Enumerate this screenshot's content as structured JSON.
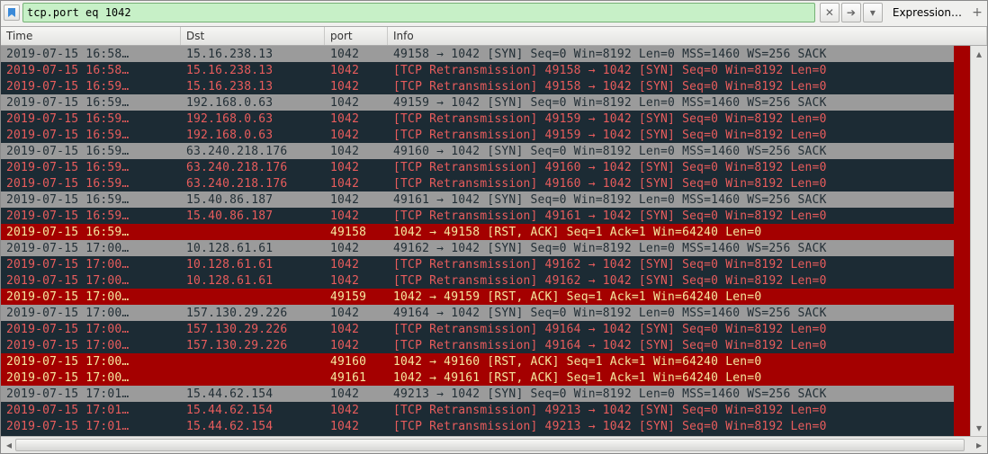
{
  "filter": {
    "value": "tcp.port eq 1042",
    "clear_label": "✕",
    "go_label": "➔",
    "expression_label": "Expression…",
    "plus_label": "+"
  },
  "columns": {
    "time": "Time",
    "dst": "Dst",
    "port": "port",
    "info": "Info"
  },
  "rows": [
    {
      "cls": "gray",
      "time": "2019-07-15 16:58…",
      "dst": "15.16.238.13",
      "port": "1042",
      "info": "49158 → 1042 [SYN] Seq=0 Win=8192 Len=0 MSS=1460 WS=256 SACK"
    },
    {
      "cls": "dark",
      "time": "2019-07-15 16:58…",
      "dst": "15.16.238.13",
      "port": "1042",
      "info": "[TCP Retransmission] 49158 → 1042 [SYN] Seq=0 Win=8192 Len=0"
    },
    {
      "cls": "dark",
      "time": "2019-07-15 16:59…",
      "dst": "15.16.238.13",
      "port": "1042",
      "info": "[TCP Retransmission] 49158 → 1042 [SYN] Seq=0 Win=8192 Len=0"
    },
    {
      "cls": "gray",
      "time": "2019-07-15 16:59…",
      "dst": "192.168.0.63",
      "port": "1042",
      "info": "49159 → 1042 [SYN] Seq=0 Win=8192 Len=0 MSS=1460 WS=256 SACK"
    },
    {
      "cls": "dark",
      "time": "2019-07-15 16:59…",
      "dst": "192.168.0.63",
      "port": "1042",
      "info": "[TCP Retransmission] 49159 → 1042 [SYN] Seq=0 Win=8192 Len=0"
    },
    {
      "cls": "dark",
      "time": "2019-07-15 16:59…",
      "dst": "192.168.0.63",
      "port": "1042",
      "info": "[TCP Retransmission] 49159 → 1042 [SYN] Seq=0 Win=8192 Len=0"
    },
    {
      "cls": "gray",
      "time": "2019-07-15 16:59…",
      "dst": "63.240.218.176",
      "port": "1042",
      "info": "49160 → 1042 [SYN] Seq=0 Win=8192 Len=0 MSS=1460 WS=256 SACK"
    },
    {
      "cls": "dark",
      "time": "2019-07-15 16:59…",
      "dst": "63.240.218.176",
      "port": "1042",
      "info": "[TCP Retransmission] 49160 → 1042 [SYN] Seq=0 Win=8192 Len=0"
    },
    {
      "cls": "dark",
      "time": "2019-07-15 16:59…",
      "dst": "63.240.218.176",
      "port": "1042",
      "info": "[TCP Retransmission] 49160 → 1042 [SYN] Seq=0 Win=8192 Len=0"
    },
    {
      "cls": "gray",
      "time": "2019-07-15 16:59…",
      "dst": "15.40.86.187",
      "port": "1042",
      "info": "49161 → 1042 [SYN] Seq=0 Win=8192 Len=0 MSS=1460 WS=256 SACK"
    },
    {
      "cls": "dark",
      "time": "2019-07-15 16:59…",
      "dst": "15.40.86.187",
      "port": "1042",
      "info": "[TCP Retransmission] 49161 → 1042 [SYN] Seq=0 Win=8192 Len=0"
    },
    {
      "cls": "red",
      "time": "2019-07-15 16:59…",
      "dst": "",
      "port": "49158",
      "info": "1042 → 49158 [RST, ACK] Seq=1 Ack=1 Win=64240 Len=0"
    },
    {
      "cls": "gray",
      "time": "2019-07-15 17:00…",
      "dst": "10.128.61.61",
      "port": "1042",
      "info": "49162 → 1042 [SYN] Seq=0 Win=8192 Len=0 MSS=1460 WS=256 SACK"
    },
    {
      "cls": "dark",
      "time": "2019-07-15 17:00…",
      "dst": "10.128.61.61",
      "port": "1042",
      "info": "[TCP Retransmission] 49162 → 1042 [SYN] Seq=0 Win=8192 Len=0"
    },
    {
      "cls": "dark",
      "time": "2019-07-15 17:00…",
      "dst": "10.128.61.61",
      "port": "1042",
      "info": "[TCP Retransmission] 49162 → 1042 [SYN] Seq=0 Win=8192 Len=0"
    },
    {
      "cls": "red",
      "time": "2019-07-15 17:00…",
      "dst": "",
      "port": "49159",
      "info": "1042 → 49159 [RST, ACK] Seq=1 Ack=1 Win=64240 Len=0"
    },
    {
      "cls": "gray",
      "time": "2019-07-15 17:00…",
      "dst": "157.130.29.226",
      "port": "1042",
      "info": "49164 → 1042 [SYN] Seq=0 Win=8192 Len=0 MSS=1460 WS=256 SACK"
    },
    {
      "cls": "dark",
      "time": "2019-07-15 17:00…",
      "dst": "157.130.29.226",
      "port": "1042",
      "info": "[TCP Retransmission] 49164 → 1042 [SYN] Seq=0 Win=8192 Len=0"
    },
    {
      "cls": "dark",
      "time": "2019-07-15 17:00…",
      "dst": "157.130.29.226",
      "port": "1042",
      "info": "[TCP Retransmission] 49164 → 1042 [SYN] Seq=0 Win=8192 Len=0"
    },
    {
      "cls": "red",
      "time": "2019-07-15 17:00…",
      "dst": "",
      "port": "49160",
      "info": "1042 → 49160 [RST, ACK] Seq=1 Ack=1 Win=64240 Len=0"
    },
    {
      "cls": "red",
      "time": "2019-07-15 17:00…",
      "dst": "",
      "port": "49161",
      "info": "1042 → 49161 [RST, ACK] Seq=1 Ack=1 Win=64240 Len=0"
    },
    {
      "cls": "gray",
      "time": "2019-07-15 17:01…",
      "dst": "15.44.62.154",
      "port": "1042",
      "info": "49213 → 1042 [SYN] Seq=0 Win=8192 Len=0 MSS=1460 WS=256 SACK"
    },
    {
      "cls": "dark",
      "time": "2019-07-15 17:01…",
      "dst": "15.44.62.154",
      "port": "1042",
      "info": "[TCP Retransmission] 49213 → 1042 [SYN] Seq=0 Win=8192 Len=0"
    },
    {
      "cls": "dark",
      "time": "2019-07-15 17:01…",
      "dst": "15.44.62.154",
      "port": "1042",
      "info": "[TCP Retransmission] 49213 → 1042 [SYN] Seq=0 Win=8192 Len=0"
    }
  ]
}
